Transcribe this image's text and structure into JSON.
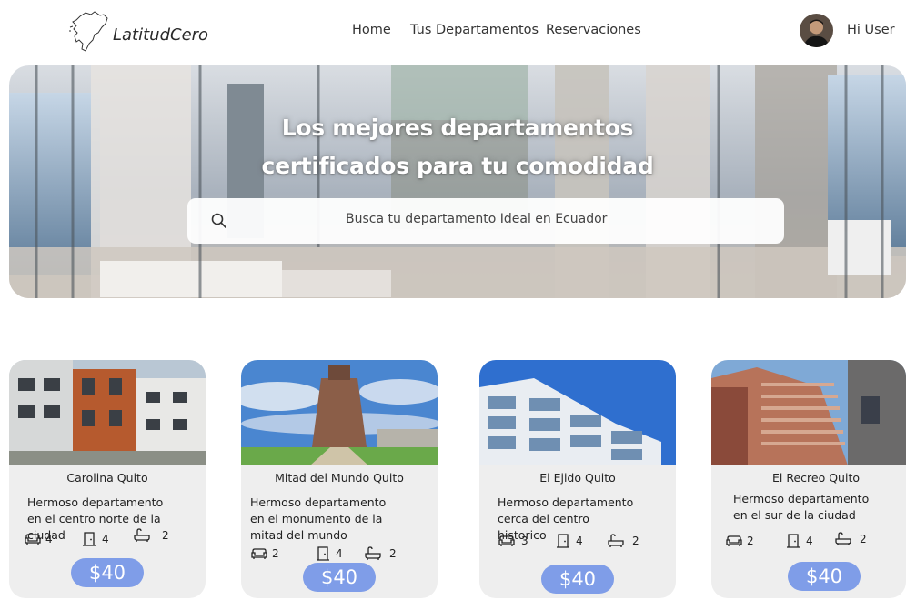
{
  "brand": {
    "name": "LatitudCero",
    "logo_icon": "ecuador-map-icon"
  },
  "nav": {
    "items": [
      "Home",
      "Tus Departamentos",
      "Reservaciones"
    ]
  },
  "user": {
    "greeting": "Hi User",
    "avatar_icon": "user-avatar"
  },
  "hero": {
    "title_line1": "Los mejores departamentos",
    "title_line2": "certificados para tu comodidad",
    "search_placeholder": "Busca tu departamento Ideal en Ecuador",
    "search_icon": "search-icon"
  },
  "cards": [
    {
      "title": "Carolina Quito",
      "description": "Hermoso departamento en el centro norte de la ciudad",
      "sofas": "4",
      "doors": "4",
      "baths": "2",
      "price": "$40"
    },
    {
      "title": "Mitad del Mundo Quito",
      "description": "Hermoso departamento en el monumento de la mitad del mundo",
      "sofas": "2",
      "doors": "4",
      "baths": "2",
      "price": "$40"
    },
    {
      "title": "El Ejido Quito",
      "description": "Hermoso departamento cerca del centro historico",
      "sofas": "3",
      "doors": "4",
      "baths": "2",
      "price": "$40"
    },
    {
      "title": "El Recreo Quito",
      "description": "Hermoso departamento en el sur de la ciudad",
      "sofas": "2",
      "doors": "4",
      "baths": "2",
      "price": "$40"
    }
  ],
  "icons": {
    "sofa": "sofa-icon",
    "door": "door-icon",
    "bath": "bathtub-icon"
  },
  "colors": {
    "price_badge": "#7f9de8",
    "card_background": "#eeeeee"
  }
}
